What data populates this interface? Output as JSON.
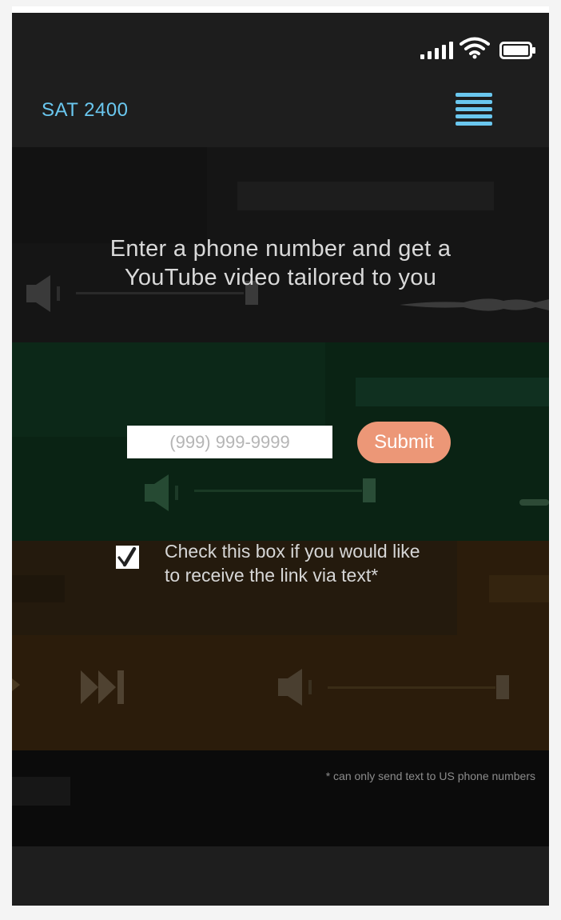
{
  "status_bar": {
    "signal_icon": "signal-bars-icon",
    "wifi_icon": "wifi-icon",
    "battery_icon": "battery-icon"
  },
  "header": {
    "brand": "SAT 2400",
    "menu_icon": "hamburger-menu-icon",
    "accent_color": "#6ac7ef"
  },
  "main": {
    "headline_line1": "Enter a phone number and get a",
    "headline_line2": "YouTube video tailored to you",
    "phone_input": {
      "value": "",
      "placeholder": "(999) 999-9999"
    },
    "submit_label": "Submit",
    "submit_color": "#ec9777",
    "sms_checkbox": {
      "checked": true,
      "label_line1": "Check this box if you would like",
      "label_line2": "to receive the link via text*"
    },
    "footnote": "* can only send text to US phone numbers"
  }
}
